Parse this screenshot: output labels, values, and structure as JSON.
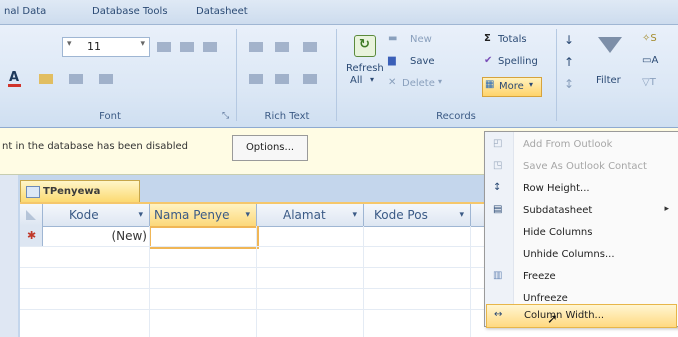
{
  "tabs": [
    "nal Data",
    "Database Tools",
    "Datasheet"
  ],
  "font_group": {
    "font_size": "11",
    "label": "Font"
  },
  "richtext_group": {
    "label": "Rich Text"
  },
  "records_group": {
    "label": "Records",
    "refresh_label": "Refresh\nAll",
    "refresh_line1": "Refresh",
    "refresh_line2": "All",
    "new": "New",
    "save": "Save",
    "delete": "Delete",
    "totals": "Totals",
    "spelling": "Spelling",
    "more": "More"
  },
  "filter_group": {
    "filter": "Filter"
  },
  "message_bar": {
    "text": "nt in the database has been disabled",
    "options_button": "Options..."
  },
  "table_tab": "TPenyewa",
  "columns": [
    "Kode",
    "Nama Penye",
    "Alamat",
    "Kode Pos"
  ],
  "new_row": "(New)",
  "menu": {
    "items": [
      {
        "label": "Add From Outlook",
        "disabled": true
      },
      {
        "label": "Save As Outlook Contact",
        "disabled": true
      },
      {
        "label": "Row Height...",
        "disabled": false
      },
      {
        "label": "Subdatasheet",
        "disabled": false,
        "submenu": true
      },
      {
        "label": "Hide Columns",
        "disabled": false
      },
      {
        "label": "Unhide Columns...",
        "disabled": false
      },
      {
        "label": "Freeze",
        "disabled": false
      },
      {
        "label": "Unfreeze",
        "disabled": false
      },
      {
        "label": "Column Width...",
        "disabled": false,
        "highlighted": true
      }
    ]
  },
  "colors": {
    "accent": "#f0b656",
    "ribbon": "#dbe7f5",
    "message_bar": "#fffce4"
  }
}
